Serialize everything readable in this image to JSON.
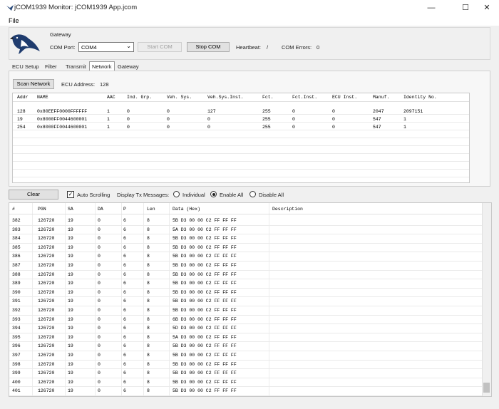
{
  "window": {
    "title": "jCOM1939 Monitor: jCOM1939 App.jcom",
    "min": "—",
    "max": "☐",
    "close": "✕"
  },
  "menu": {
    "file": "File"
  },
  "gateway": {
    "label": "Gateway",
    "com_port_label": "COM Port:",
    "com_port_value": "COM4",
    "start_label": "Start COM",
    "stop_label": "Stop COM",
    "heartbeat_label": "Heartbeat:",
    "heartbeat_value": "/",
    "com_errors_label": "COM Errors:",
    "com_errors_value": "0"
  },
  "tabs": [
    "ECU Setup",
    "Filter",
    "Transmit",
    "Network",
    "Gateway"
  ],
  "network": {
    "scan_label": "Scan Network",
    "ecu_address_label": "ECU Address:",
    "ecu_address_value": "128",
    "columns": [
      "Addr",
      "NAME",
      "AAC",
      "Ind. Grp.",
      "Veh. Sys.",
      "Veh.Sys.Inst.",
      "Fct.",
      "Fct.Inst.",
      "ECU Inst.",
      "Manuf.",
      "Identity No."
    ],
    "rows": [
      [
        "128",
        "0x80EEFF0000FFFFFF",
        "1",
        "0",
        "0",
        "127",
        "255",
        "0",
        "0",
        "2047",
        "2097151"
      ],
      [
        "19",
        "0x8000FF0044600001",
        "1",
        "0",
        "0",
        "0",
        "255",
        "0",
        "0",
        "547",
        "1"
      ],
      [
        "254",
        "0x8000FF0044600001",
        "1",
        "0",
        "0",
        "0",
        "255",
        "0",
        "0",
        "547",
        "1"
      ]
    ]
  },
  "log_controls": {
    "clear_label": "Clear",
    "auto_scroll_label": "Auto Scrolling",
    "display_tx_label": "Display Tx Messages:",
    "individual_label": "Individual",
    "enable_all_label": "Enable All",
    "disable_all_label": "Disable All",
    "selected": "Enable All"
  },
  "log": {
    "columns": [
      "#",
      "PGN",
      "SA",
      "DA",
      "P",
      "Len",
      "Data (Hex)",
      "Description"
    ],
    "rows": [
      [
        "382",
        "126720",
        "19",
        "0",
        "6",
        "8",
        "5B D3 00 00 C2 FF FF FF"
      ],
      [
        "383",
        "126720",
        "19",
        "0",
        "6",
        "8",
        "5A D3 00 00 C2 FF FF FF"
      ],
      [
        "384",
        "126720",
        "19",
        "0",
        "6",
        "8",
        "5B D3 00 00 C2 FF FF FF"
      ],
      [
        "385",
        "126720",
        "19",
        "0",
        "6",
        "8",
        "5B D3 00 00 C2 FF FF FF"
      ],
      [
        "386",
        "126720",
        "19",
        "0",
        "6",
        "8",
        "5B D3 00 00 C2 FF FF FF"
      ],
      [
        "387",
        "126720",
        "19",
        "0",
        "6",
        "8",
        "5B D3 00 00 C2 FF FF FF"
      ],
      [
        "388",
        "126720",
        "19",
        "0",
        "6",
        "8",
        "5B D3 00 00 C2 FF FF FF"
      ],
      [
        "389",
        "126720",
        "19",
        "0",
        "6",
        "8",
        "5B D3 00 00 C2 FF FF FF"
      ],
      [
        "390",
        "126720",
        "19",
        "0",
        "6",
        "8",
        "5B D3 00 00 C2 FF FF FF"
      ],
      [
        "391",
        "126720",
        "19",
        "0",
        "6",
        "8",
        "5B D3 00 00 C2 FF FF FF"
      ],
      [
        "392",
        "126720",
        "19",
        "0",
        "6",
        "8",
        "5B D3 00 00 C2 FF FF FF"
      ],
      [
        "393",
        "126720",
        "19",
        "0",
        "6",
        "8",
        "6B D3 00 00 C2 FF FF FF"
      ],
      [
        "394",
        "126720",
        "19",
        "0",
        "6",
        "8",
        "5D D3 00 00 C2 FF FF FF"
      ],
      [
        "395",
        "126720",
        "19",
        "0",
        "6",
        "8",
        "5A D3 00 00 C2 FF FF FF"
      ],
      [
        "396",
        "126720",
        "19",
        "0",
        "6",
        "8",
        "5B D3 00 00 C2 FF FF FF"
      ],
      [
        "397",
        "126720",
        "19",
        "0",
        "6",
        "8",
        "5B D3 00 00 C2 FF FF FF"
      ],
      [
        "398",
        "126720",
        "19",
        "0",
        "6",
        "8",
        "5B D3 00 00 C2 FF FF FF"
      ],
      [
        "399",
        "126720",
        "19",
        "0",
        "6",
        "8",
        "5B D3 00 00 C2 FF FF FF"
      ],
      [
        "400",
        "126720",
        "19",
        "0",
        "6",
        "8",
        "5B D3 00 00 C2 FF FF FF"
      ],
      [
        "401",
        "126720",
        "19",
        "0",
        "6",
        "8",
        "5B D3 00 00 C2 FF FF FF"
      ]
    ]
  }
}
